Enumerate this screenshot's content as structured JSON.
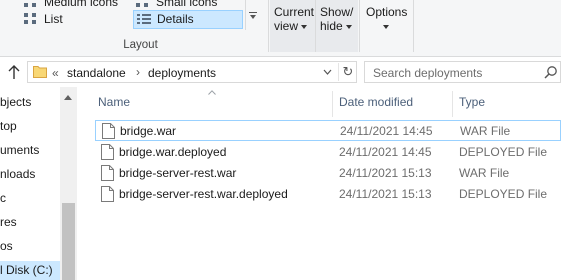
{
  "ribbon": {
    "layout": {
      "items": [
        {
          "label": "Medium icons",
          "icon": "grid-icon"
        },
        {
          "label": "Small icons",
          "icon": "grid-small-icon"
        },
        {
          "label": "List",
          "icon": "list-icon"
        },
        {
          "label": "Details",
          "icon": "details-icon",
          "selected": true
        }
      ],
      "group_label": "Layout"
    },
    "current_view": {
      "line1": "Current",
      "line2": "view"
    },
    "show_hide": {
      "line1": "Show/",
      "line2": "hide"
    },
    "options": {
      "label": "Options"
    }
  },
  "address": {
    "prefix": "«",
    "crumbs": [
      "standalone",
      "deployments"
    ],
    "search_placeholder": "Search deployments"
  },
  "navpane": {
    "items": [
      "bjects",
      "top",
      "uments",
      "nloads",
      "c",
      "res",
      "os",
      "l Disk (C:)"
    ],
    "selected_index": 7
  },
  "columns": {
    "name": "Name",
    "date": "Date modified",
    "type": "Type"
  },
  "files": [
    {
      "name": "bridge.war",
      "date": "24/11/2021 14:45",
      "type": "WAR File",
      "selected": true
    },
    {
      "name": "bridge.war.deployed",
      "date": "24/11/2021 14:45",
      "type": "DEPLOYED File"
    },
    {
      "name": "bridge-server-rest.war",
      "date": "24/11/2021 15:13",
      "type": "WAR File"
    },
    {
      "name": "bridge-server-rest.war.deployed",
      "date": "24/11/2021 15:13",
      "type": "DEPLOYED File"
    }
  ],
  "colors": {
    "selection_bg": "#cce8ff",
    "selection_border": "#99d1ff",
    "header_text": "#4c607a",
    "secondary_text": "#6d6d6d"
  }
}
